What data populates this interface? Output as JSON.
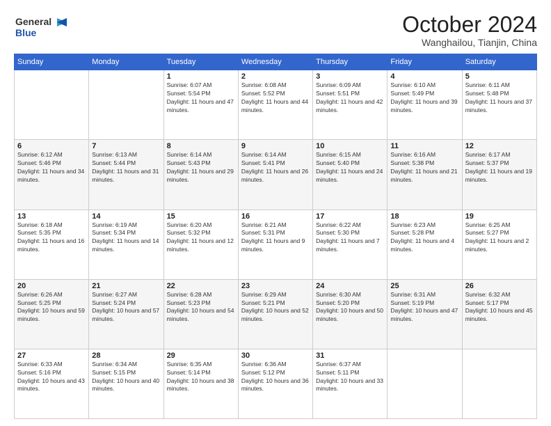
{
  "header": {
    "logo_line1": "General",
    "logo_line2": "Blue",
    "month": "October 2024",
    "location": "Wanghailou, Tianjin, China"
  },
  "weekdays": [
    "Sunday",
    "Monday",
    "Tuesday",
    "Wednesday",
    "Thursday",
    "Friday",
    "Saturday"
  ],
  "weeks": [
    [
      {
        "day": "",
        "info": ""
      },
      {
        "day": "",
        "info": ""
      },
      {
        "day": "1",
        "info": "Sunrise: 6:07 AM\nSunset: 5:54 PM\nDaylight: 11 hours and 47 minutes."
      },
      {
        "day": "2",
        "info": "Sunrise: 6:08 AM\nSunset: 5:52 PM\nDaylight: 11 hours and 44 minutes."
      },
      {
        "day": "3",
        "info": "Sunrise: 6:09 AM\nSunset: 5:51 PM\nDaylight: 11 hours and 42 minutes."
      },
      {
        "day": "4",
        "info": "Sunrise: 6:10 AM\nSunset: 5:49 PM\nDaylight: 11 hours and 39 minutes."
      },
      {
        "day": "5",
        "info": "Sunrise: 6:11 AM\nSunset: 5:48 PM\nDaylight: 11 hours and 37 minutes."
      }
    ],
    [
      {
        "day": "6",
        "info": "Sunrise: 6:12 AM\nSunset: 5:46 PM\nDaylight: 11 hours and 34 minutes."
      },
      {
        "day": "7",
        "info": "Sunrise: 6:13 AM\nSunset: 5:44 PM\nDaylight: 11 hours and 31 minutes."
      },
      {
        "day": "8",
        "info": "Sunrise: 6:14 AM\nSunset: 5:43 PM\nDaylight: 11 hours and 29 minutes."
      },
      {
        "day": "9",
        "info": "Sunrise: 6:14 AM\nSunset: 5:41 PM\nDaylight: 11 hours and 26 minutes."
      },
      {
        "day": "10",
        "info": "Sunrise: 6:15 AM\nSunset: 5:40 PM\nDaylight: 11 hours and 24 minutes."
      },
      {
        "day": "11",
        "info": "Sunrise: 6:16 AM\nSunset: 5:38 PM\nDaylight: 11 hours and 21 minutes."
      },
      {
        "day": "12",
        "info": "Sunrise: 6:17 AM\nSunset: 5:37 PM\nDaylight: 11 hours and 19 minutes."
      }
    ],
    [
      {
        "day": "13",
        "info": "Sunrise: 6:18 AM\nSunset: 5:35 PM\nDaylight: 11 hours and 16 minutes."
      },
      {
        "day": "14",
        "info": "Sunrise: 6:19 AM\nSunset: 5:34 PM\nDaylight: 11 hours and 14 minutes."
      },
      {
        "day": "15",
        "info": "Sunrise: 6:20 AM\nSunset: 5:32 PM\nDaylight: 11 hours and 12 minutes."
      },
      {
        "day": "16",
        "info": "Sunrise: 6:21 AM\nSunset: 5:31 PM\nDaylight: 11 hours and 9 minutes."
      },
      {
        "day": "17",
        "info": "Sunrise: 6:22 AM\nSunset: 5:30 PM\nDaylight: 11 hours and 7 minutes."
      },
      {
        "day": "18",
        "info": "Sunrise: 6:23 AM\nSunset: 5:28 PM\nDaylight: 11 hours and 4 minutes."
      },
      {
        "day": "19",
        "info": "Sunrise: 6:25 AM\nSunset: 5:27 PM\nDaylight: 11 hours and 2 minutes."
      }
    ],
    [
      {
        "day": "20",
        "info": "Sunrise: 6:26 AM\nSunset: 5:25 PM\nDaylight: 10 hours and 59 minutes."
      },
      {
        "day": "21",
        "info": "Sunrise: 6:27 AM\nSunset: 5:24 PM\nDaylight: 10 hours and 57 minutes."
      },
      {
        "day": "22",
        "info": "Sunrise: 6:28 AM\nSunset: 5:23 PM\nDaylight: 10 hours and 54 minutes."
      },
      {
        "day": "23",
        "info": "Sunrise: 6:29 AM\nSunset: 5:21 PM\nDaylight: 10 hours and 52 minutes."
      },
      {
        "day": "24",
        "info": "Sunrise: 6:30 AM\nSunset: 5:20 PM\nDaylight: 10 hours and 50 minutes."
      },
      {
        "day": "25",
        "info": "Sunrise: 6:31 AM\nSunset: 5:19 PM\nDaylight: 10 hours and 47 minutes."
      },
      {
        "day": "26",
        "info": "Sunrise: 6:32 AM\nSunset: 5:17 PM\nDaylight: 10 hours and 45 minutes."
      }
    ],
    [
      {
        "day": "27",
        "info": "Sunrise: 6:33 AM\nSunset: 5:16 PM\nDaylight: 10 hours and 43 minutes."
      },
      {
        "day": "28",
        "info": "Sunrise: 6:34 AM\nSunset: 5:15 PM\nDaylight: 10 hours and 40 minutes."
      },
      {
        "day": "29",
        "info": "Sunrise: 6:35 AM\nSunset: 5:14 PM\nDaylight: 10 hours and 38 minutes."
      },
      {
        "day": "30",
        "info": "Sunrise: 6:36 AM\nSunset: 5:12 PM\nDaylight: 10 hours and 36 minutes."
      },
      {
        "day": "31",
        "info": "Sunrise: 6:37 AM\nSunset: 5:11 PM\nDaylight: 10 hours and 33 minutes."
      },
      {
        "day": "",
        "info": ""
      },
      {
        "day": "",
        "info": ""
      }
    ]
  ]
}
